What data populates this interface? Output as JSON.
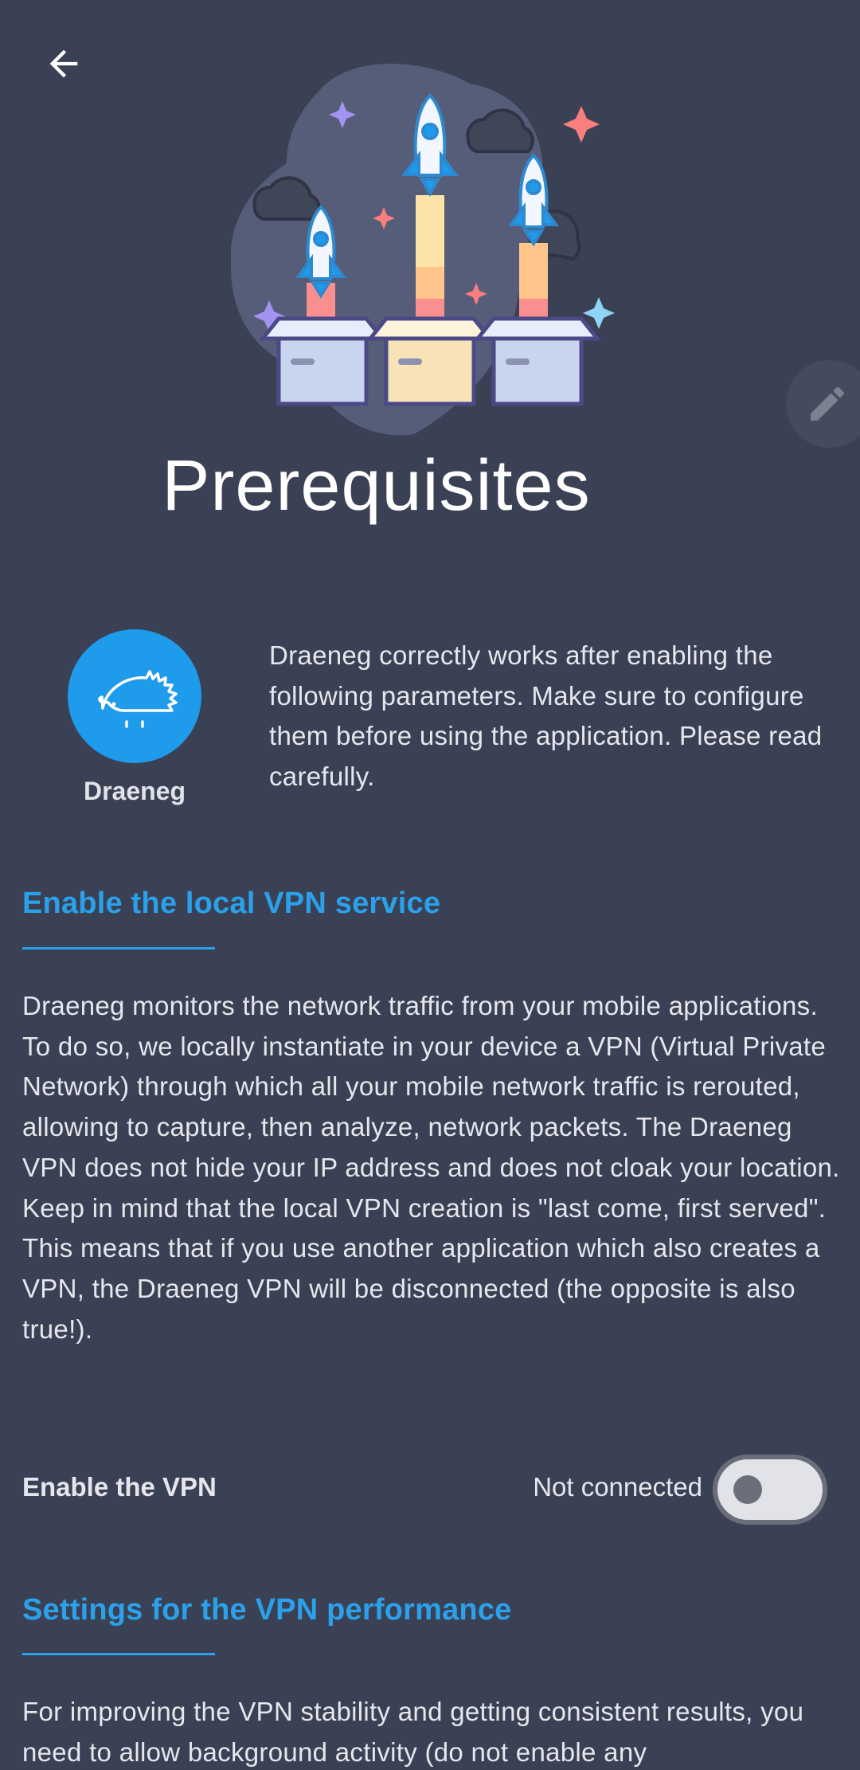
{
  "header": {
    "back_icon": "arrow-left-icon",
    "title": "Prerequisites",
    "edit_icon": "pencil-icon"
  },
  "app": {
    "name": "Draeneg",
    "logo_icon": "hedgehog-icon",
    "intro": "Draeneg correctly works after enabling the following parameters. Make sure to configure them before using the application. Please read carefully."
  },
  "sections": [
    {
      "title": "Enable the local VPN service",
      "paragraphs": [
        "Draeneg monitors the network traffic from your mobile applications. To do so, we locally instantiate in your device a VPN (Virtual Private Network) through which all your mobile network traffic is rerouted, allowing to capture, then analyze, network packets. The Draeneg VPN does not hide your IP address and does not cloak your location.",
        "Keep in mind that the local VPN creation is \"last come, first served\". This means that if you use another application which also creates a VPN, the Draeneg VPN will be disconnected (the opposite is also true!)."
      ],
      "setting": {
        "label": "Enable the VPN",
        "status": "Not connected",
        "toggle_on": false
      }
    },
    {
      "title": "Settings for the VPN performance",
      "paragraphs": [
        "For improving the VPN stability and getting consistent results, you need to allow background activity (do not enable any"
      ]
    }
  ],
  "colors": {
    "background": "#3b4154",
    "accent": "#2aa1ea",
    "avatar": "#1e9bea"
  }
}
